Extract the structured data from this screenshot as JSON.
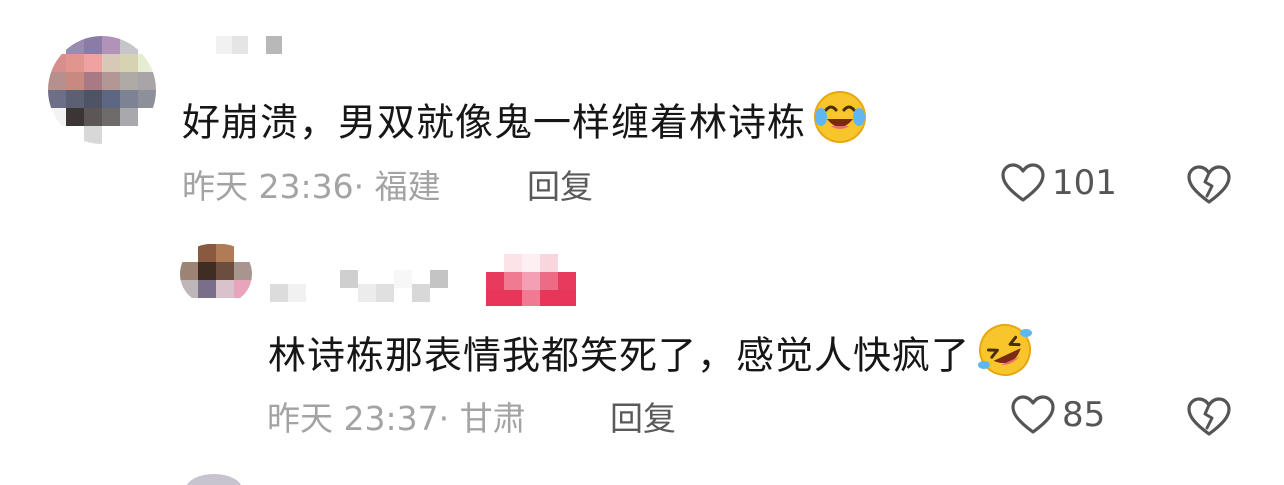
{
  "comments": [
    {
      "text": "好崩溃，男双就像鬼一样缠着林诗栋",
      "emoji": "crying-laughing-emoji",
      "time_location": "昨天 23:36· 福建",
      "reply_label": "回复",
      "likes": "101"
    },
    {
      "text": "林诗栋那表情我都笑死了，感觉人快疯了",
      "emoji": "rolling-laughing-emoji",
      "time_location": "昨天 23:37· 甘肃",
      "reply_label": "回复",
      "likes": "85"
    }
  ],
  "icons": {
    "like": "heart-outline-icon",
    "dislike": "broken-heart-icon"
  },
  "colors": {
    "text": "#161616",
    "meta": "#a3a3a3",
    "icon": "#555555",
    "badge": "#e83a5c"
  }
}
